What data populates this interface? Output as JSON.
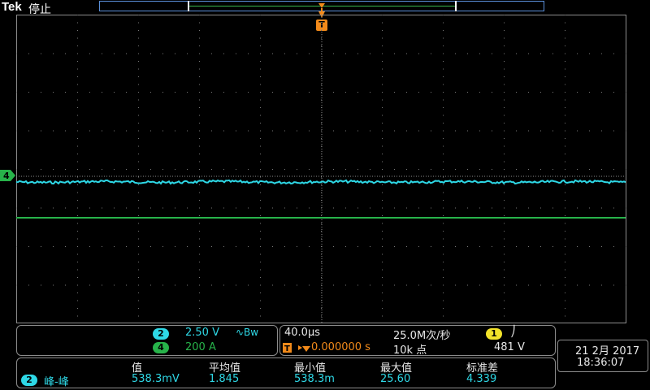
{
  "header": {
    "brand": "Tek",
    "run_state": "停止"
  },
  "markers": {
    "trigger_letter": "T",
    "ch4_marker": "4"
  },
  "channels": {
    "ch2": {
      "number": "2",
      "scale": "2.50 V",
      "bandwidth_glyph": "∿Bw",
      "color": "#2ed8e6"
    },
    "ch4": {
      "number": "4",
      "scale": "200 A",
      "color": "#27b34a"
    }
  },
  "timebase": {
    "horizontal_scale": "40.0µs",
    "sample_rate": "25.0M次/秒",
    "trigger_delay": "0.000000 s",
    "record_length": "10k 点"
  },
  "trigger": {
    "source": "1",
    "slope_glyph": "⎠",
    "level": "481 V",
    "color": "#f2e22a"
  },
  "measurements": {
    "headers": [
      "值",
      "平均值",
      "最小值",
      "最大值",
      "标准差"
    ],
    "row": {
      "channel": "2",
      "name": "峰-峰",
      "values": [
        "538.3mV",
        "1.845",
        "538.3m",
        "25.60",
        "4.339"
      ]
    }
  },
  "datetime": {
    "date": "21 2月 2017",
    "time": "18:36:07"
  },
  "colors": {
    "ch2": "#2ed8e6",
    "ch4": "#27b34a",
    "trigger_marker": "#f28a1a",
    "graticule": "#8c8c8c"
  }
}
